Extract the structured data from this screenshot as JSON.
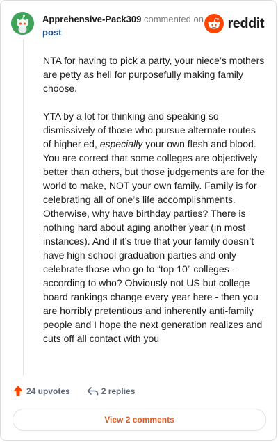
{
  "comment": {
    "username": "Apprehensive-Pack309",
    "action": "commented on",
    "target": "post",
    "paragraphs": [
      {
        "before": "NTA for having to pick a party, your niece’s mothers are petty as hell for purposefully making family choose.",
        "em": "",
        "after": ""
      },
      {
        "before": "YTA by a lot for thinking and speaking so dismissively of those who pursue alternate routes of higher ed, ",
        "em": "especially",
        "after": " your own flesh and blood. You are correct that some colleges are objectively better than others, but those judgements are for the world to make, NOT your own family. Family is for celebrating all of one’s life accomplishments. Otherwise, why have birthday parties? There is nothing hard about aging another year (in most instances). And if it’s true that your family doesn’t have high school graduation parties and only celebrate those who go to “top 10” colleges - according to who? Obviously not US but college board rankings change every year here - then you are horribly pretentious and inherently anti-family people and I hope the next generation realizes and cuts off all contact with you"
      }
    ],
    "upvotes_label": "24 upvotes",
    "replies_label": "2 replies",
    "view_comments_label": "View 2 comments"
  },
  "brand": {
    "name": "reddit",
    "logo_icon": "reddit-logo-icon"
  },
  "icons": {
    "avatar": "snoo-avatar-icon",
    "upvote": "upvote-arrow-icon",
    "reply": "reply-arrow-icon"
  },
  "colors": {
    "accent": "#ff4500",
    "avatar_bg": "#3fa35b",
    "link": "#1a4b8c",
    "view_comments": "#d95b2a",
    "muted": "#7c7c7c"
  }
}
